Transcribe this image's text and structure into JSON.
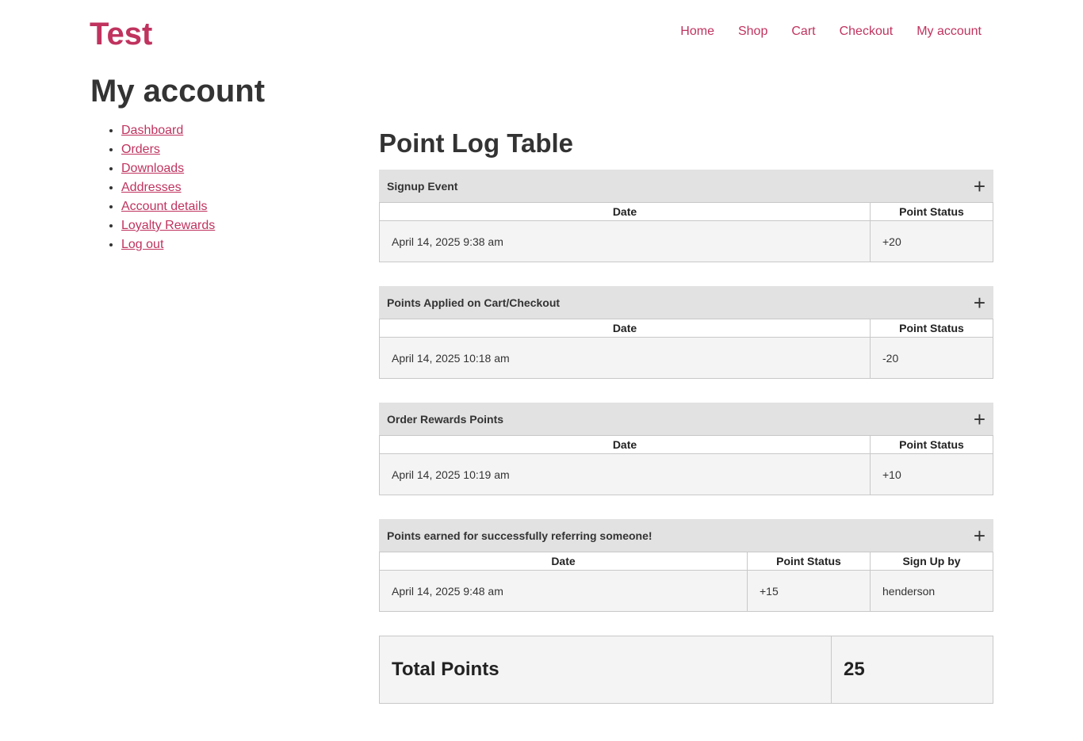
{
  "site": {
    "title": "Test"
  },
  "nav": [
    {
      "label": "Home"
    },
    {
      "label": "Shop"
    },
    {
      "label": "Cart"
    },
    {
      "label": "Checkout"
    },
    {
      "label": "My account"
    }
  ],
  "page": {
    "title": "My account"
  },
  "account_nav": [
    {
      "label": "Dashboard"
    },
    {
      "label": "Orders"
    },
    {
      "label": "Downloads"
    },
    {
      "label": "Addresses"
    },
    {
      "label": "Account details"
    },
    {
      "label": "Loyalty Rewards"
    },
    {
      "label": "Log out"
    }
  ],
  "point_log": {
    "title": "Point Log Table",
    "sections": [
      {
        "title": "Signup Event",
        "toggle_icon": "plus-icon",
        "columns": [
          "Date",
          "Point Status"
        ],
        "rows": [
          [
            "April 14, 2025 9:38 am",
            "+20"
          ]
        ]
      },
      {
        "title": "Points Applied on Cart/Checkout",
        "toggle_icon": "plus-icon",
        "columns": [
          "Date",
          "Point Status"
        ],
        "rows": [
          [
            "April 14, 2025 10:18 am",
            "-20"
          ]
        ]
      },
      {
        "title": "Order Rewards Points",
        "toggle_icon": "plus-icon",
        "columns": [
          "Date",
          "Point Status"
        ],
        "rows": [
          [
            "April 14, 2025 10:19 am",
            "+10"
          ]
        ]
      },
      {
        "title": "Points earned for successfully referring someone!",
        "toggle_icon": "plus-icon",
        "columns": [
          "Date",
          "Point Status",
          "Sign Up by"
        ],
        "rows": [
          [
            "April 14, 2025 9:48 am",
            "+15",
            "henderson"
          ]
        ]
      }
    ],
    "total": {
      "label": "Total Points",
      "value": "25"
    }
  },
  "colors": {
    "accent": "#c0335f",
    "header_bg": "#e2e2e2",
    "cell_bg": "#f4f4f4",
    "border": "#c8c8c8"
  }
}
